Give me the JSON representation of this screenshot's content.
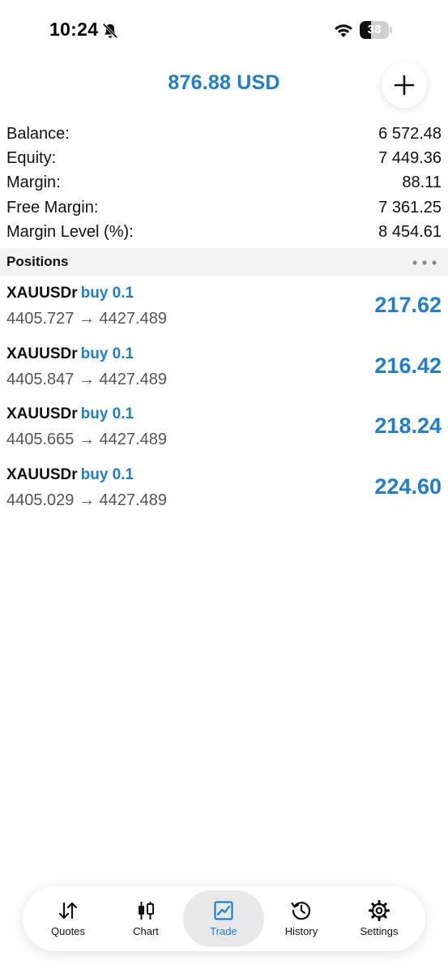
{
  "status_bar": {
    "time": "10:24",
    "battery_level": "38",
    "battery_fraction": 0.38
  },
  "header": {
    "title": "876.88 USD",
    "add_button_icon": "plus-icon"
  },
  "summary": [
    {
      "label": "Balance:",
      "value": "6 572.48"
    },
    {
      "label": "Equity:",
      "value": "7 449.36"
    },
    {
      "label": "Margin:",
      "value": "88.11"
    },
    {
      "label": "Free Margin:",
      "value": "7 361.25"
    },
    {
      "label": "Margin Level (%):",
      "value": "8 454.61"
    }
  ],
  "positions_section": {
    "title": "Positions",
    "more_icon": "more-horizontal-icon"
  },
  "positions": [
    {
      "symbol": "XAUUSDr",
      "side": "buy 0.1",
      "prices": "4405.727 → 4427.489",
      "profit": "217.62"
    },
    {
      "symbol": "XAUUSDr",
      "side": "buy 0.1",
      "prices": "4405.847 → 4427.489",
      "profit": "216.42"
    },
    {
      "symbol": "XAUUSDr",
      "side": "buy 0.1",
      "prices": "4405.665 → 4427.489",
      "profit": "218.24"
    },
    {
      "symbol": "XAUUSDr",
      "side": "buy 0.1",
      "prices": "4405.029 → 4427.489",
      "profit": "224.60"
    }
  ],
  "tabs": [
    {
      "label": "Quotes",
      "icon": "quotes-arrows-icon",
      "active": false
    },
    {
      "label": "Chart",
      "icon": "candlestick-chart-icon",
      "active": false
    },
    {
      "label": "Trade",
      "icon": "trade-chart-icon",
      "active": true
    },
    {
      "label": "History",
      "icon": "history-clock-icon",
      "active": false
    },
    {
      "label": "Settings",
      "icon": "gear-icon",
      "active": false
    }
  ],
  "colors": {
    "accent": "#1e7fcf",
    "section_bg": "#f3f3f3",
    "active_tab_bg": "#e8e8e8"
  }
}
